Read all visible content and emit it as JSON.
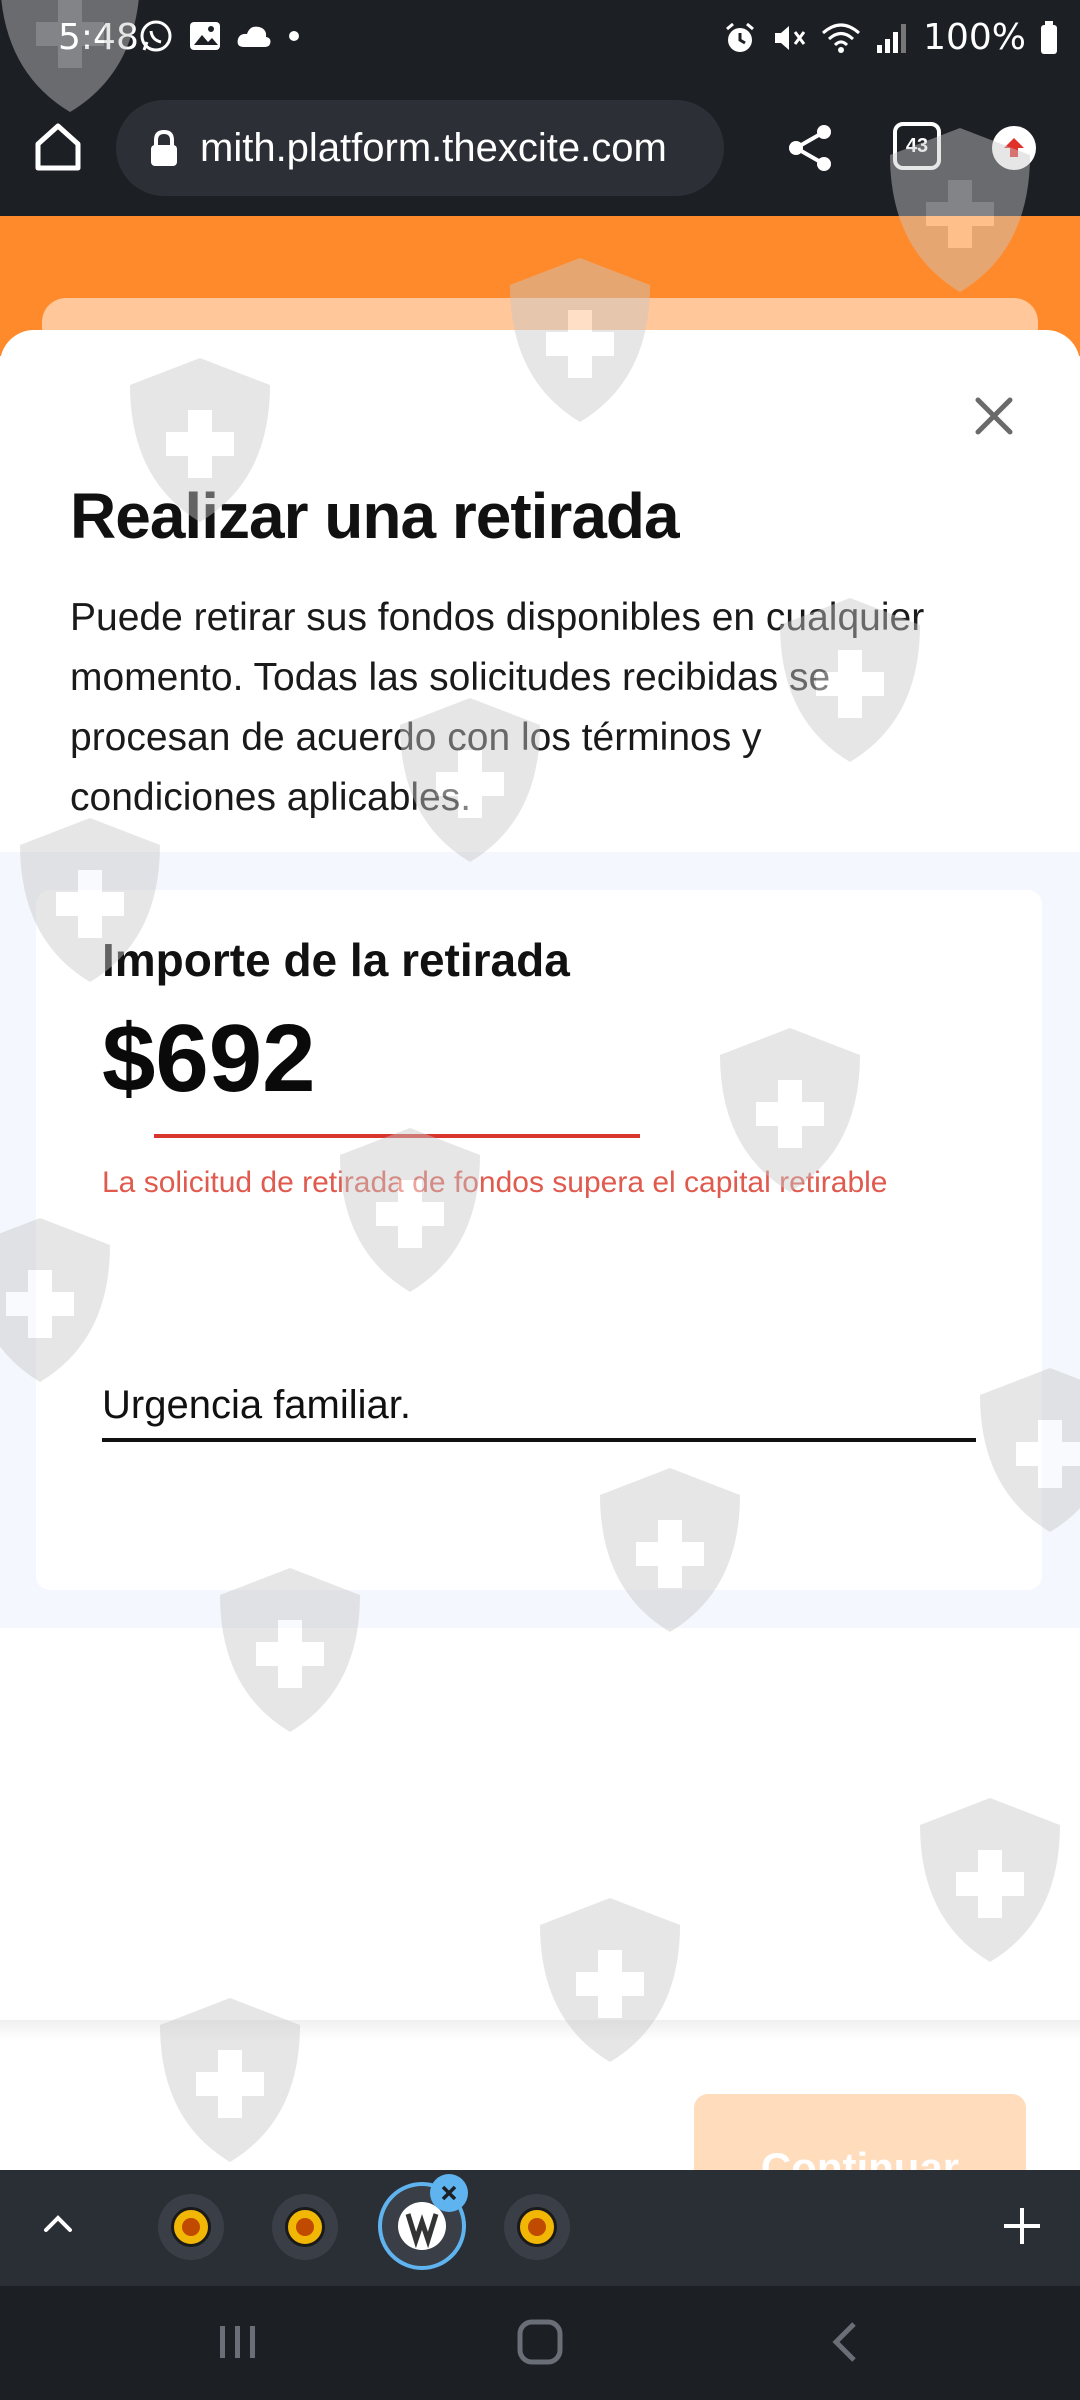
{
  "status_bar": {
    "time": "5:48",
    "battery": "100%",
    "left_icons": [
      "whatsapp-icon",
      "gallery-icon",
      "cloud-icon",
      "dot-icon"
    ],
    "right_icons": [
      "alarm-icon",
      "mute-icon",
      "wifi-icon",
      "signal-icon",
      "battery-icon"
    ]
  },
  "browser": {
    "url": "mith.platform.thexcite.com",
    "tab_count": "43"
  },
  "modal": {
    "title": "Realizar una retirada",
    "description": "Puede retirar sus fondos disponibles en cualquier momento. Todas las solicitudes recibidas se procesan de acuerdo con los términos y condiciones aplicables.",
    "amount_label": "Importe de la retirada",
    "amount_value": "$692",
    "amount_error": "La solicitud de retirada de fondos supera el capital retirable",
    "reason_value": "Urgencia familiar.",
    "continue_label": "Continuar"
  },
  "colors": {
    "accent_orange": "#ff8a2b",
    "error_red": "#d9352d",
    "disabled_button": "#ffdcbc"
  }
}
